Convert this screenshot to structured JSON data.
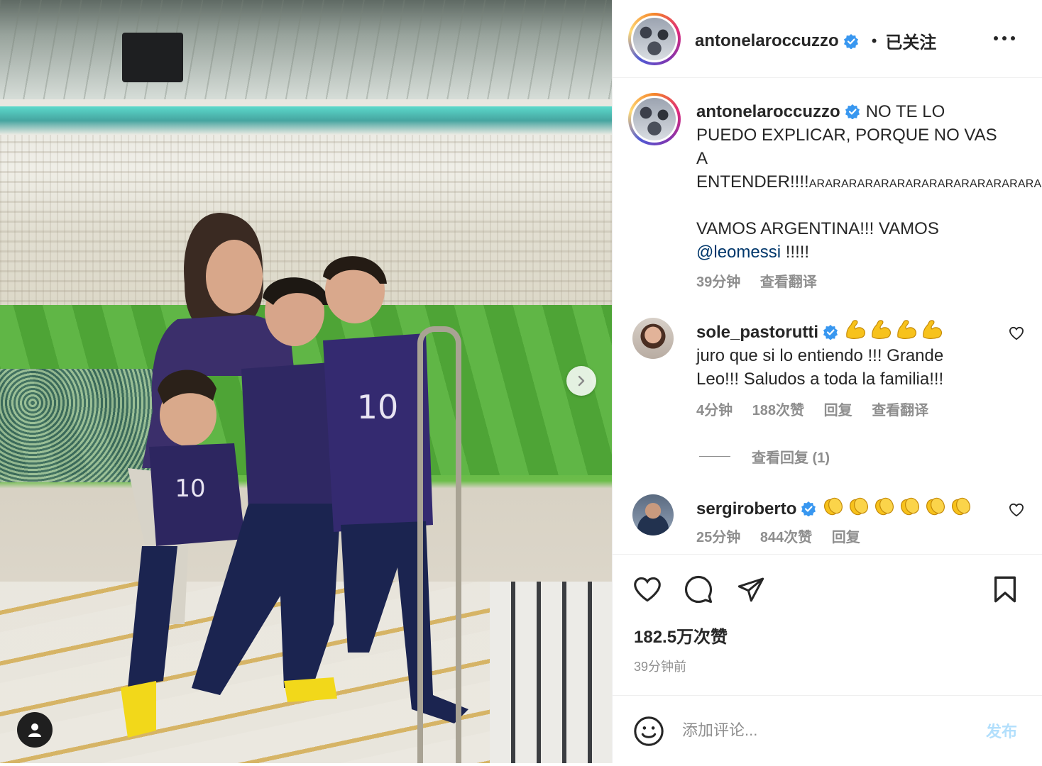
{
  "post": {
    "username": "antonelaroccuzzo",
    "verified": true,
    "separator": "•",
    "follow_state": "已关注",
    "more_icon": "more-horizontal-icon"
  },
  "caption": {
    "username": "antonelaroccuzzo",
    "text_main": "NO TE LO PUEDO EXPLICAR, PORQUE NO VAS A ENTENDER!!!!",
    "text_small": "ARARARARARARARARARARARARARARARARARAR",
    "line2_prefix": "VAMOS ARGENTINA!!! VAMOS",
    "mention": "@leomessi",
    "line2_suffix": " !!!!!",
    "time": "39分钟",
    "translate": "查看翻译"
  },
  "comments": [
    {
      "username": "sole_pastorutti",
      "verified": true,
      "emoji": "flexed-biceps-icon",
      "emoji_count": 4,
      "text": "juro que si lo entiendo !!! Grande Leo!!! Saludos a toda la familia!!!",
      "time": "4分钟",
      "likes": "188次赞",
      "reply": "回复",
      "translate": "查看翻译",
      "view_replies": "查看回复 (1)"
    },
    {
      "username": "sergiroberto",
      "verified": true,
      "emoji": "clapping-hands-icon",
      "emoji_count": 6,
      "time": "25分钟",
      "likes": "844次赞",
      "reply": "回复"
    }
  ],
  "actions": {
    "like_icon": "heart-icon",
    "comment_icon": "comment-icon",
    "share_icon": "share-icon",
    "save_icon": "bookmark-icon",
    "likes": "182.5万次赞",
    "timestamp": "39分钟前"
  },
  "composer": {
    "placeholder": "添加评论...",
    "post_label": "发布",
    "emoji_icon": "smiley-icon"
  },
  "colors": {
    "verified_blue": "#3897f0",
    "link_blue": "#00376b",
    "muted_gray": "#8e8e8e",
    "post_disabled": "#b2dffc"
  }
}
